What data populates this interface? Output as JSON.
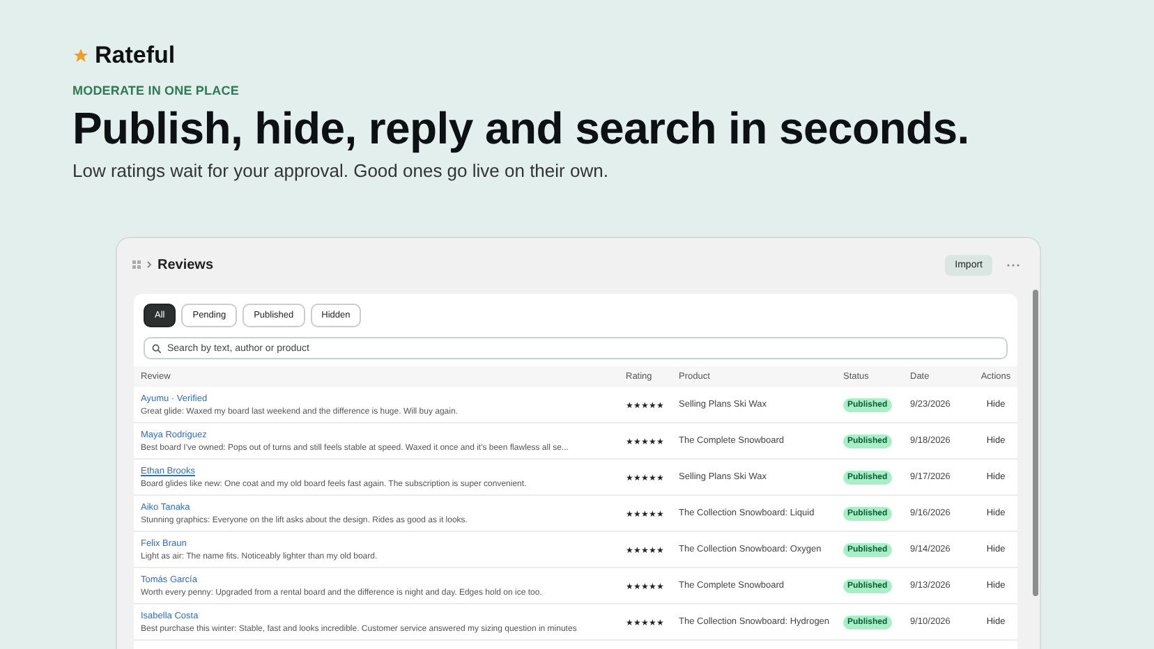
{
  "brand": {
    "name": "Rateful"
  },
  "eyebrow": "MODERATE IN ONE PLACE",
  "headline": "Publish, hide, reply and search in seconds.",
  "subhead": "Low ratings wait for your approval. Good ones go live on their own.",
  "app": {
    "title": "Reviews",
    "actions": [
      "Import"
    ],
    "filters": [
      {
        "label": "All",
        "selected": true
      },
      {
        "label": "Pending",
        "selected": false
      },
      {
        "label": "Published",
        "selected": false
      },
      {
        "label": "Hidden",
        "selected": false
      }
    ],
    "search": {
      "placeholder": "Search by text, author or product"
    },
    "table": {
      "columns": [
        "Review",
        "Rating",
        "Product",
        "Status",
        "Date",
        "Actions"
      ],
      "rows": [
        {
          "author": "Ayumu · Verified",
          "hovered": false,
          "text": "Great glide: Waxed my board last weekend and the difference is huge. Will buy again.",
          "stars": 5,
          "product": "Selling Plans Ski Wax",
          "status": {
            "label": "Published",
            "kind": "published"
          },
          "date": "9/23/2026",
          "action": "Hide"
        },
        {
          "author": "Maya Rodriguez",
          "hovered": false,
          "text": "Best board I've owned: Pops out of turns and still feels stable at speed. Waxed it once and it's been flawless all se...",
          "stars": 5,
          "product": "The Complete Snowboard",
          "status": {
            "label": "Published",
            "kind": "published"
          },
          "date": "9/18/2026",
          "action": "Hide"
        },
        {
          "author": "Ethan Brooks",
          "hovered": true,
          "text": "Board glides like new: One coat and my old board feels fast again. The subscription is super convenient.",
          "stars": 5,
          "product": "Selling Plans Ski Wax",
          "status": {
            "label": "Published",
            "kind": "published"
          },
          "date": "9/17/2026",
          "action": "Hide"
        },
        {
          "author": "Aiko Tanaka",
          "hovered": false,
          "text": "Stunning graphics: Everyone on the lift asks about the design. Rides as good as it looks.",
          "stars": 5,
          "product": "The Collection Snowboard: Liquid",
          "status": {
            "label": "Published",
            "kind": "published"
          },
          "date": "9/16/2026",
          "action": "Hide"
        },
        {
          "author": "Felix Braun",
          "hovered": false,
          "text": "Light as air: The name fits. Noticeably lighter than my old board.",
          "stars": 5,
          "product": "The Collection Snowboard: Oxygen",
          "status": {
            "label": "Published",
            "kind": "published"
          },
          "date": "9/14/2026",
          "action": "Hide"
        },
        {
          "author": "Tomás García",
          "hovered": false,
          "text": "Worth every penny: Upgraded from a rental board and the difference is night and day. Edges hold on ice too.",
          "stars": 5,
          "product": "The Complete Snowboard",
          "status": {
            "label": "Published",
            "kind": "published"
          },
          "date": "9/13/2026",
          "action": "Hide"
        },
        {
          "author": "Isabella Costa",
          "hovered": false,
          "text": "Best purchase this winter: Stable, fast and looks incredible. Customer service answered my sizing question in minutes",
          "stars": 5,
          "product": "The Collection Snowboard: Hydrogen",
          "status": {
            "label": "Published",
            "kind": "published"
          },
          "date": "9/10/2026",
          "action": "Hide"
        }
      ]
    }
  }
}
